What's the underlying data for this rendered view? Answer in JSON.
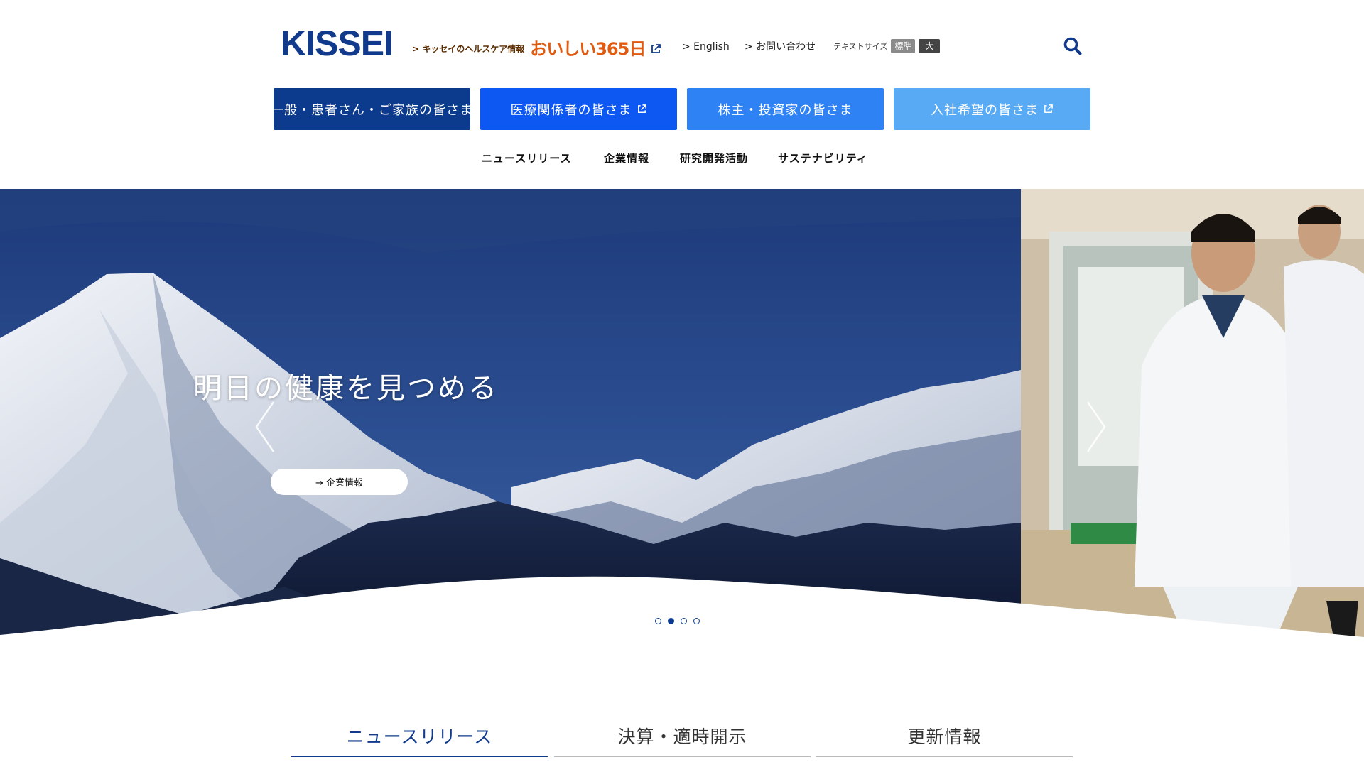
{
  "header": {
    "logo": "KISSEI",
    "health_link": "> キッセイのヘルスケア情報",
    "health_brand": "おいしい365日",
    "english_link": "> English",
    "contact_link": "> お問い合わせ",
    "text_size_label": "テキストサイズ",
    "text_size_standard": "標準",
    "text_size_large": "大",
    "search_icon": "search-icon"
  },
  "audience_nav": [
    {
      "label": "一般・患者さん・ご家族の皆さま",
      "color": "#0c3b8e",
      "external": false
    },
    {
      "label": "医療関係者の皆さま",
      "color": "#0d58f2",
      "external": true
    },
    {
      "label": "株主・投資家の皆さま",
      "color": "#2f82f3",
      "external": false
    },
    {
      "label": "入社希望の皆さま",
      "color": "#58aaf4",
      "external": true
    }
  ],
  "global_nav": [
    {
      "label": "ニュースリリース"
    },
    {
      "label": "企業情報"
    },
    {
      "label": "研究開発活動"
    },
    {
      "label": "サステナビリティ"
    }
  ],
  "hero": {
    "title": "明日の健康を見つめる",
    "button_label": "→ 企業情報",
    "current_slide": 2,
    "total_slides": 4
  },
  "tabs": [
    {
      "label": "ニュースリリース",
      "active": true
    },
    {
      "label": "決算・適時開示",
      "active": false
    },
    {
      "label": "更新情報",
      "active": false
    }
  ],
  "colors": {
    "brand_navy": "#123a8c",
    "accent_orange": "#e05a10"
  }
}
